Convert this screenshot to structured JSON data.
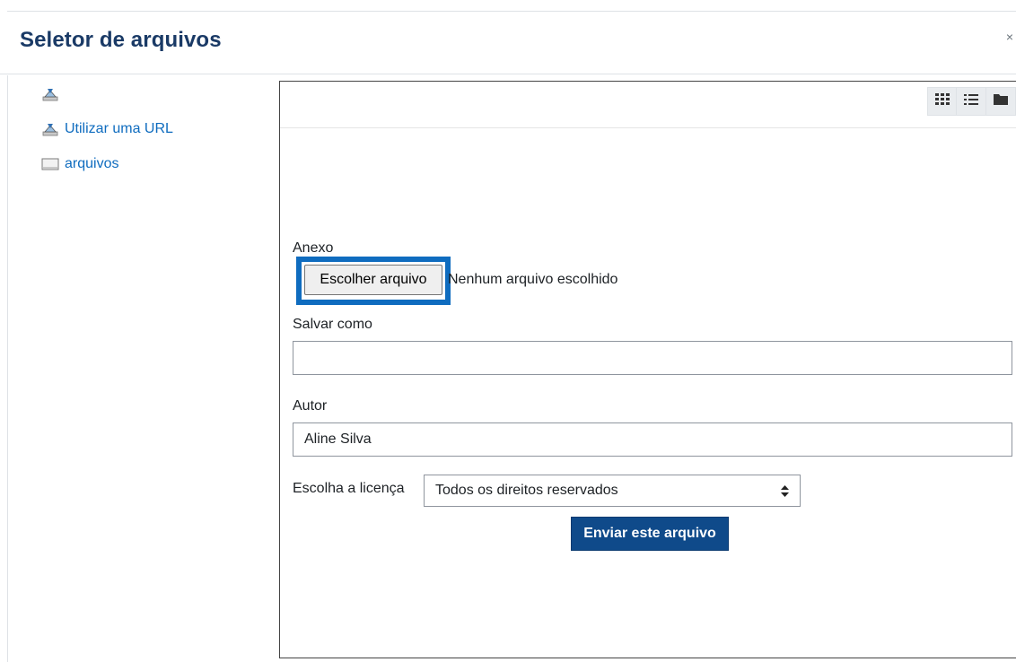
{
  "dialog": {
    "title": "Seletor de arquivos",
    "close_label": "×"
  },
  "sidebar": {
    "items": [
      {
        "label": "",
        "icon": "repository-upload-icon"
      },
      {
        "label": "Utilizar uma URL",
        "icon": "repository-url-icon"
      },
      {
        "label": "arquivos",
        "icon": "repository-files-icon"
      }
    ]
  },
  "toolbar": {
    "views": [
      {
        "name": "icons-view",
        "icon": "grid-icon"
      },
      {
        "name": "list-view",
        "icon": "list-icon"
      },
      {
        "name": "tree-view",
        "icon": "folder-icon"
      }
    ]
  },
  "form": {
    "attachment_label": "Anexo",
    "file_button_label": "Escolher arquivo",
    "file_status": "Nenhum arquivo escolhido",
    "save_as_label": "Salvar como",
    "save_as_value": "",
    "author_label": "Autor",
    "author_value": "Aline Silva",
    "license_label": "Escolha a licença",
    "license_value": "Todos os direitos reservados",
    "submit_label": "Enviar este arquivo"
  },
  "colors": {
    "title": "#1a3a66",
    "link": "#0f6cbf",
    "highlight": "#0f6cbf",
    "primary_button": "#0f4a8a"
  }
}
